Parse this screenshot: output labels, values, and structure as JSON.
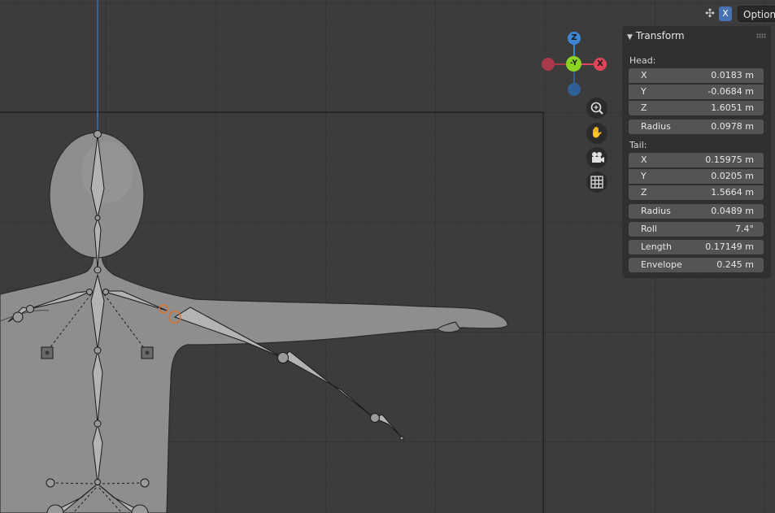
{
  "header": {
    "x_toggle": "X",
    "options_label": "Options"
  },
  "gizmo": {
    "z_label": "Z",
    "y_label": "-Y",
    "x_label": "X",
    "colors": {
      "x": "#e04459",
      "y": "#8cd424",
      "z": "#3d86d6",
      "neg_x": "#a8384a",
      "neg_z": "#2f5f96"
    }
  },
  "nav_icons": [
    "zoom-icon",
    "pan-hand-icon",
    "camera-icon",
    "grid-ortho-icon"
  ],
  "transform_panel": {
    "title": "Transform",
    "head_label": "Head:",
    "head": [
      {
        "label": "X",
        "value": "0.0183 m"
      },
      {
        "label": "Y",
        "value": "-0.0684 m"
      },
      {
        "label": "Z",
        "value": "1.6051 m"
      }
    ],
    "head_radius": {
      "label": "Radius",
      "value": "0.0978 m"
    },
    "tail_label": "Tail:",
    "tail": [
      {
        "label": "X",
        "value": "0.15975 m"
      },
      {
        "label": "Y",
        "value": "0.0205 m"
      },
      {
        "label": "Z",
        "value": "1.5664 m"
      }
    ],
    "tail_radius": {
      "label": "Radius",
      "value": "0.0489 m"
    },
    "roll": {
      "label": "Roll",
      "value": "7.4°"
    },
    "length": {
      "label": "Length",
      "value": "0.17149 m"
    },
    "envelope": {
      "label": "Envelope",
      "value": "0.245 m"
    }
  }
}
